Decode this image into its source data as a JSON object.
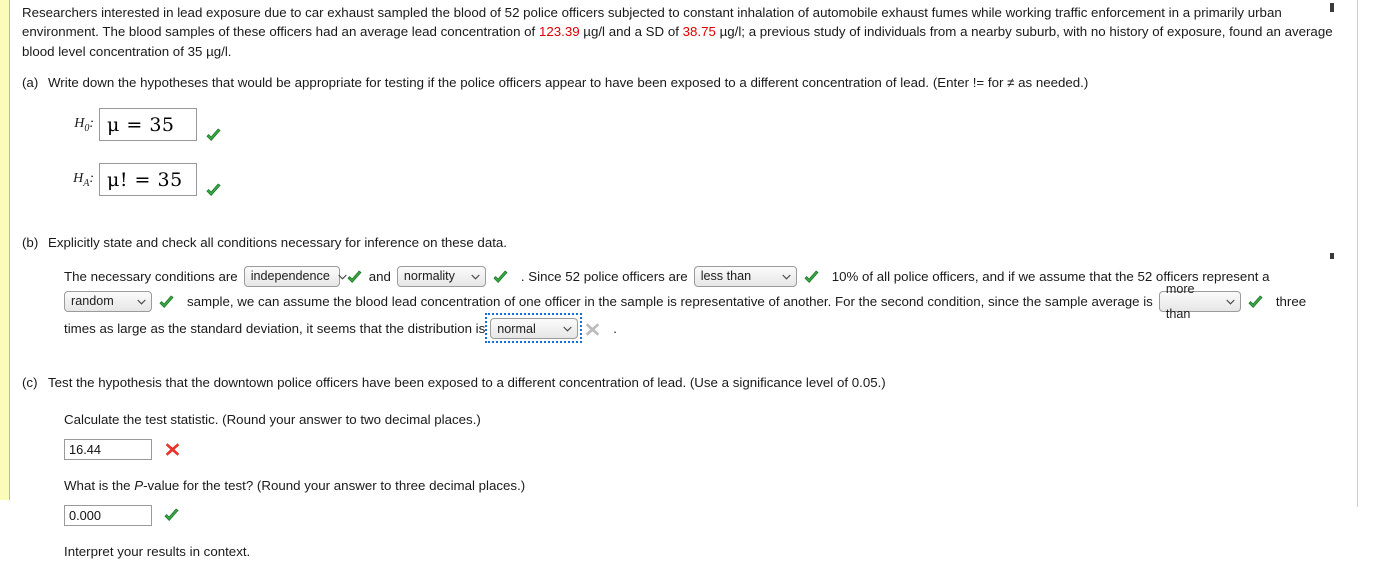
{
  "intro": {
    "seg1": "Researchers interested in lead exposure due to car exhaust sampled the blood of 52 police officers subjected to constant inhalation of automobile exhaust fumes while working traffic enforcement in a primarily urban environment. The blood samples of these officers had an average lead concentration of ",
    "mean": "123.39",
    "seg2": " µg/l and a SD of ",
    "sd": "38.75",
    "seg3": " µg/l; a previous study of individuals from a nearby suburb, with no history of exposure, found an average blood level concentration of 35 µg/l."
  },
  "parts": {
    "a": {
      "letter": "(a)",
      "prompt": "Write down the hypotheses that would be appropriate for testing if the police officers appear to have been exposed to a different concentration of lead. (Enter != for ≠ as needed.)",
      "null_label": "H",
      "null_sub": "0",
      "null_colon": ":",
      "null_value": "μ = 35",
      "null_status": "correct",
      "alt_label": "H",
      "alt_sub": "A",
      "alt_colon": ":",
      "alt_value": "μ! = 35",
      "alt_status": "correct"
    },
    "b": {
      "letter": "(b)",
      "prompt": "Explicitly state and check all conditions necessary for inference on these data.",
      "t1": "The necessary conditions are",
      "sel_cond1": "independence",
      "sel_cond1_status": "correct",
      "t2": "and",
      "sel_cond2": "normality",
      "sel_cond2_status": "correct",
      "t3": ". Since 52 police officers are",
      "sel_cond3": "less than",
      "sel_cond3_status": "correct",
      "t4": "10% of all police officers, and if we assume that the 52 officers represent a",
      "sel_cond4": "random",
      "sel_cond4_status": "correct",
      "t5": "sample, we can assume the blood lead concentration of one officer in the sample is representative of another. For the second condition, since the sample average is",
      "sel_cond5": "more than",
      "sel_cond5_status": "correct",
      "t6": "three times as large as the standard deviation, it seems that the distribution is",
      "sel_cond6": "normal",
      "sel_cond6_status": "incorrect-faded",
      "t7": "."
    },
    "c": {
      "letter": "(c)",
      "prompt": "Test the hypothesis that the downtown police officers have been exposed to a different concentration of lead. (Use a significance level of 0.05.)",
      "q1": "Calculate the test statistic. (Round your answer to two decimal places.)",
      "a1_value": "16.44",
      "a1_status": "incorrect",
      "q2_pre": "What is the ",
      "q2_italic": "P",
      "q2_post": "-value for the test? (Round your answer to three decimal places.)",
      "a2_value": "0.000",
      "a2_status": "correct",
      "q3": "Interpret your results in context."
    }
  },
  "icons": {
    "check": "green-check-icon",
    "cross": "red-cross-icon",
    "cross_faded": "grey-cross-icon",
    "chevron": "chevron-down-icon"
  },
  "colors": {
    "highlight_number": "#e00000",
    "check_green": "#3aa844",
    "cross_red": "#e8332a",
    "cross_grey": "#b4b4b4",
    "focus_blue": "#1a6fd4",
    "left_strip_yellow": "#fcfcba"
  }
}
